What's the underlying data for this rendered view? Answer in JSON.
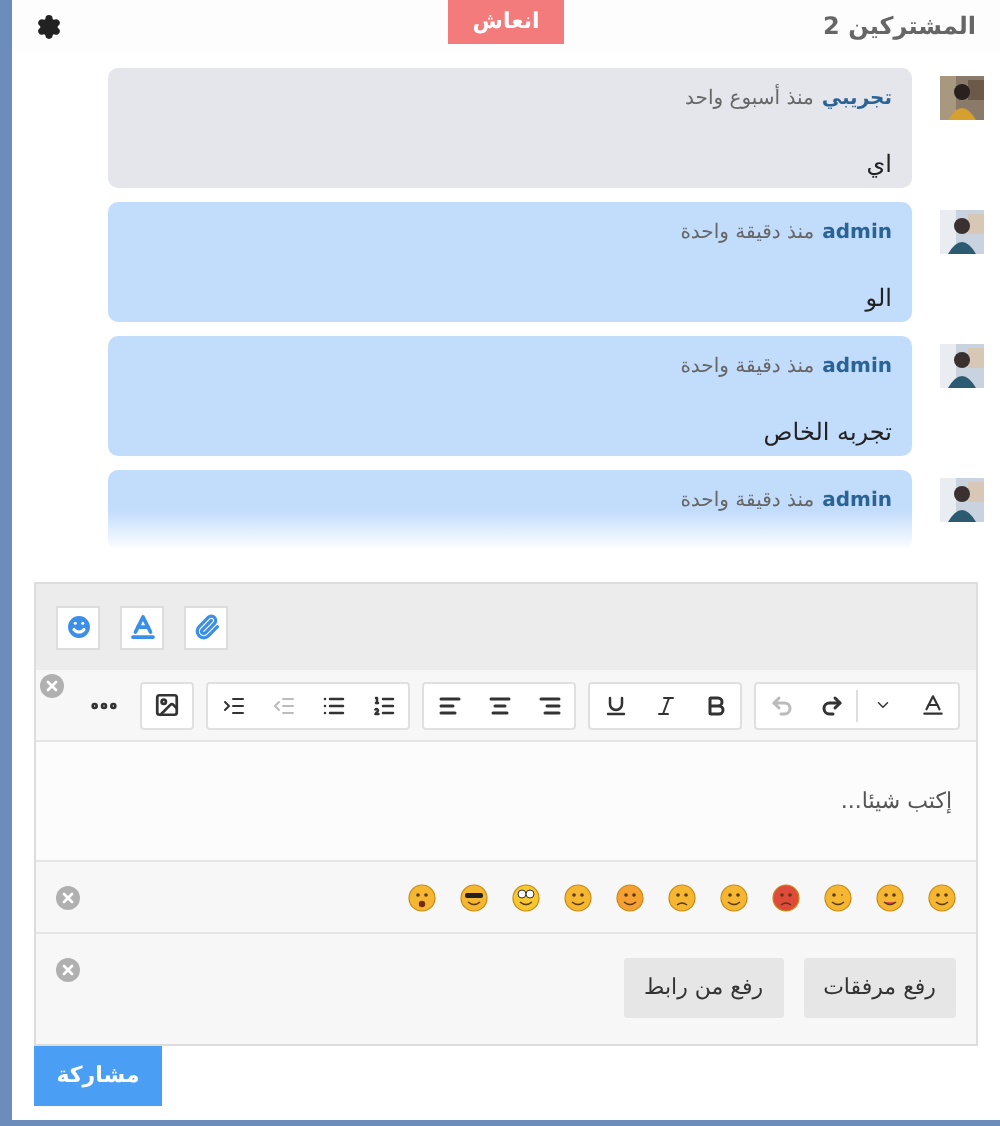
{
  "header": {
    "participants": "المشتركين 2",
    "refresh_button": "انعاش"
  },
  "messages": [
    {
      "kind": "other",
      "author": "تجريبي",
      "time": "منذ أسبوع واحد",
      "text": "اي"
    },
    {
      "kind": "mine",
      "author": "admin",
      "time": "منذ دقيقة واحدة",
      "text": "الو"
    },
    {
      "kind": "mine",
      "author": "admin",
      "time": "منذ دقيقة واحدة",
      "text": "تجربه الخاص"
    },
    {
      "kind": "mine",
      "author": "admin",
      "time": "منذ دقيقة واحدة",
      "faded": true
    }
  ],
  "editor": {
    "placeholder": "إكتب شيئا..."
  },
  "upload_buttons": [
    "رفع مرفقات",
    "رفع من رابط"
  ],
  "share_button": "مشاركة"
}
